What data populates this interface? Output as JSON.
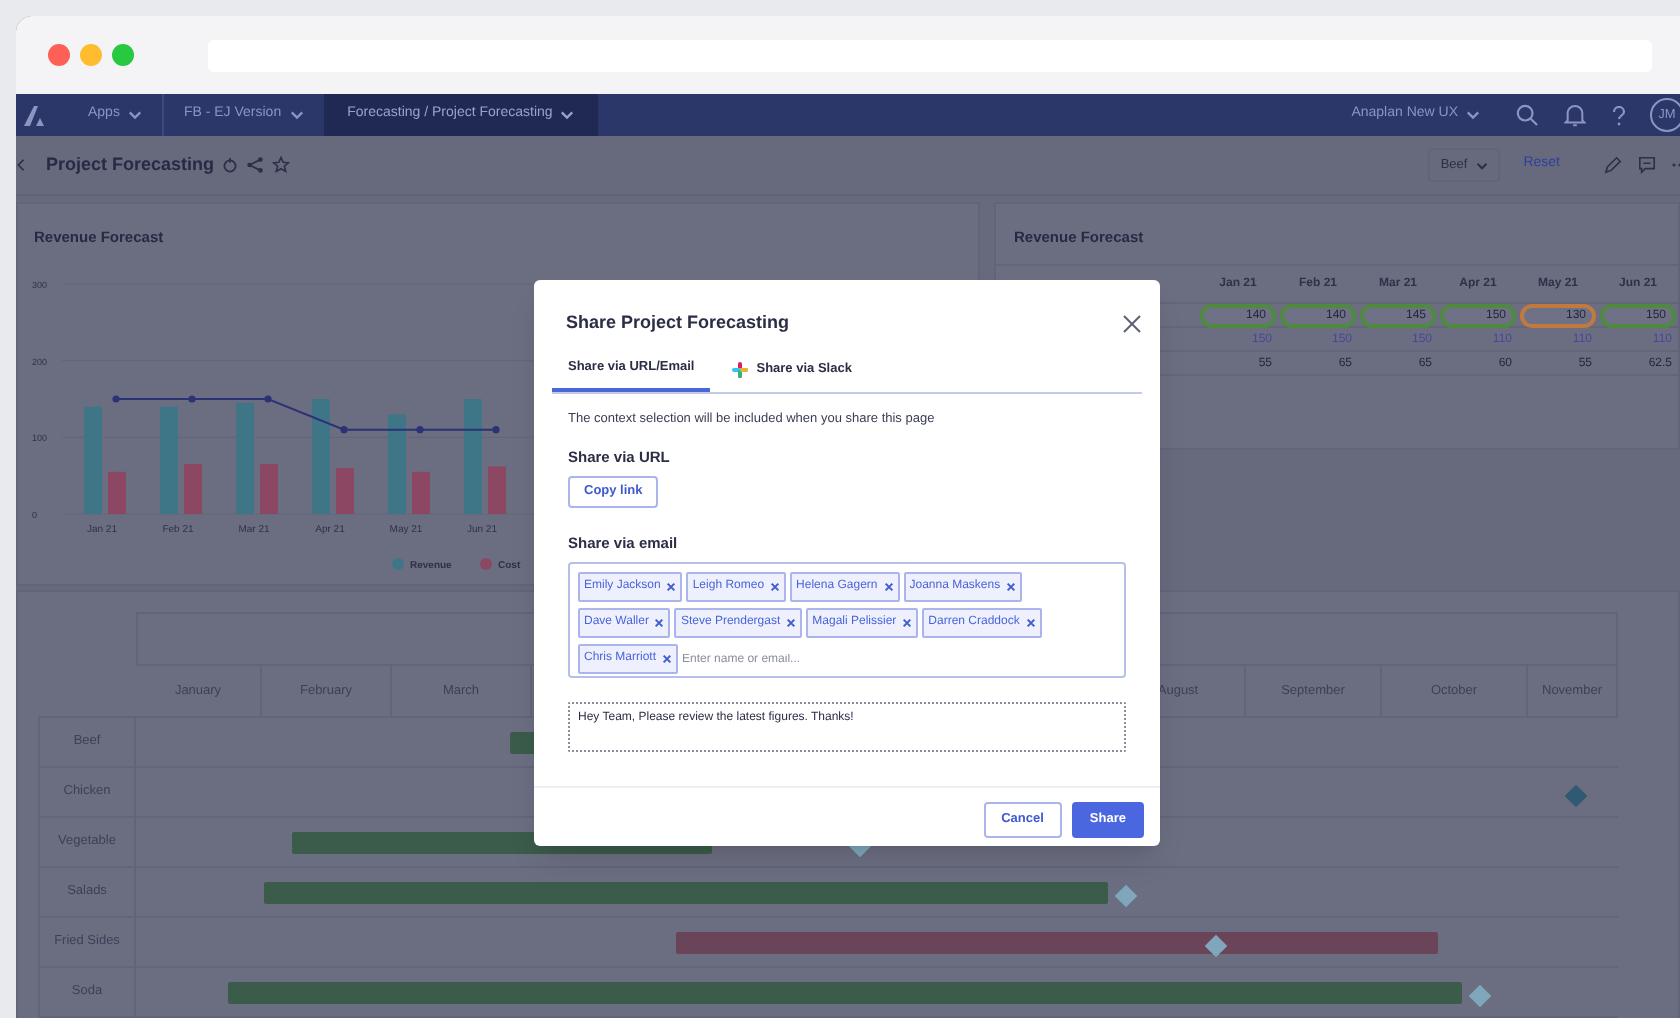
{
  "nav": {
    "items": [
      {
        "label": "Apps",
        "selected": false
      },
      {
        "label": "FB - EJ Version",
        "selected": false
      },
      {
        "label": "Forecasting / Project Forecasting",
        "selected": true
      }
    ],
    "workspace": "Anaplan New UX",
    "avatar": "JM"
  },
  "page": {
    "title": "Project Forecasting",
    "filter": "Beef",
    "reset": "Reset"
  },
  "revenue_chart": {
    "title": "Revenue Forecast",
    "chart_data": {
      "type": "bar",
      "legend": "bottom",
      "categories": [
        "Jan 21",
        "Feb 21",
        "Mar 21",
        "Apr 21",
        "May 21",
        "Jun 21"
      ],
      "ylim": [
        0,
        300
      ],
      "yticks": [
        0,
        100,
        200,
        300
      ],
      "series": [
        {
          "name": "Revenue",
          "color": "#3f7687",
          "values": [
            140,
            140,
            145,
            150,
            130,
            150
          ]
        },
        {
          "name": "Cost",
          "color": "#8c4862",
          "values": [
            55,
            65,
            65,
            60,
            55,
            62
          ]
        },
        {
          "type": "line",
          "marker": "circle",
          "color": "#2b3375",
          "values": [
            150,
            150,
            150,
            110,
            110,
            110
          ]
        }
      ]
    }
  },
  "revenue_table": {
    "title": "Revenue Forecast",
    "columns": [
      "Jan 21",
      "Feb 21",
      "Mar 21",
      "Apr 21",
      "May 21",
      "Jun 21"
    ],
    "rows": [
      {
        "kind": "status",
        "cells": [
          {
            "value": "140",
            "color": "#4f8a3f"
          },
          {
            "value": "140",
            "color": "#4f8a3f"
          },
          {
            "value": "145",
            "color": "#4f8a3f"
          },
          {
            "value": "150",
            "color": "#4f8a3f"
          },
          {
            "value": "130",
            "color": "#c0793f"
          },
          {
            "value": "150",
            "color": "#4f8a3f"
          }
        ]
      },
      {
        "kind": "input",
        "cells": [
          "150",
          "150",
          "150",
          "110",
          "110",
          "110"
        ]
      },
      {
        "kind": "plain",
        "cells": [
          "55",
          "65",
          "65",
          "60",
          "55",
          "62.5"
        ]
      }
    ]
  },
  "gantt": {
    "columns": [
      "January",
      "February",
      "March",
      "August",
      "September",
      "October",
      "November"
    ],
    "rows": [
      {
        "label": "Beef",
        "bar": {
          "color": "#3b5c4a"
        }
      },
      {
        "label": "Chicken",
        "milestone": {
          "color": "#2f5a72"
        }
      },
      {
        "label": "Vegetable",
        "bar": {
          "color": "#3b5c4a"
        },
        "milestone": {
          "color": "#7fa6ba"
        }
      },
      {
        "label": "Salads",
        "bar": {
          "color": "#3b5c4a"
        },
        "milestone": {
          "color": "#7fa6ba"
        }
      },
      {
        "label": "Fried Sides",
        "bar": {
          "color": "#6a455a"
        },
        "milestone": {
          "color": "#7fa6ba"
        }
      },
      {
        "label": "Soda",
        "bar": {
          "color": "#3b5c4a"
        },
        "milestone": {
          "color": "#7fa6ba"
        }
      }
    ]
  },
  "share_dialog": {
    "title": "Share Project Forecasting",
    "tabs": [
      {
        "label": "Share via URL/Email",
        "selected": true
      },
      {
        "label": "Share via Slack",
        "selected": false
      }
    ],
    "note": "The context selection will be included when you share this page",
    "url_heading": "Share via URL",
    "copy_button": "Copy link",
    "email_heading": "Share via email",
    "recipients": [
      "Emily Jackson",
      "Leigh Romeo",
      "Helena Gagern",
      "Joanna Maskens",
      "Dave Waller",
      "Steve Prendergast",
      "Magali Pelissier",
      "Darren Craddock",
      "Chris Marriott"
    ],
    "email_placeholder": "Enter name or email...",
    "message": "Hey Team, Please review the latest figures. Thanks!",
    "buttons": [
      {
        "label": "Cancel",
        "kind": "secondary"
      },
      {
        "label": "Share",
        "kind": "primary"
      }
    ]
  }
}
